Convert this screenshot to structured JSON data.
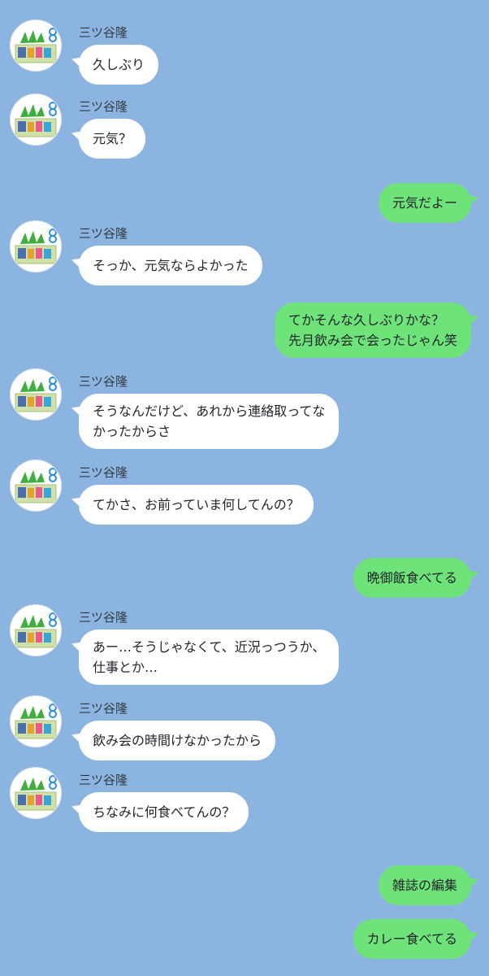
{
  "contact": {
    "name": "三ツ谷隆",
    "avatar_icon": "sewing-box-icon"
  },
  "colors": {
    "background": "#8bb5e0",
    "incoming_bubble": "#ffffff",
    "outgoing_bubble": "#6ee37a"
  },
  "messages": [
    {
      "from": "contact",
      "lines": [
        "久しぶり"
      ]
    },
    {
      "from": "contact",
      "lines": [
        "元気？"
      ]
    },
    {
      "from": "me",
      "lines": [
        "元気だよー"
      ]
    },
    {
      "from": "contact",
      "lines": [
        "そっか、元気ならよかった"
      ]
    },
    {
      "from": "me",
      "lines": [
        "てかそんな久しぶりかな？",
        "先月飲み会で会ったじゃん笑"
      ]
    },
    {
      "from": "contact",
      "lines": [
        "そうなんだけど、あれから連絡取ってな",
        "かったからさ"
      ]
    },
    {
      "from": "contact",
      "lines": [
        "てかさ、お前っていま何してんの？"
      ]
    },
    {
      "from": "me",
      "lines": [
        "晩御飯食べてる"
      ]
    },
    {
      "from": "contact",
      "lines": [
        "あー…そうじゃなくて、近況っつうか、",
        "仕事とか…"
      ]
    },
    {
      "from": "contact",
      "lines": [
        "飲み会の時間けなかったから"
      ]
    },
    {
      "from": "contact",
      "lines": [
        "ちなみに何食べてんの？"
      ]
    },
    {
      "from": "me",
      "lines": [
        "雑誌の編集"
      ]
    },
    {
      "from": "me",
      "lines": [
        "カレー食べてる"
      ]
    }
  ]
}
